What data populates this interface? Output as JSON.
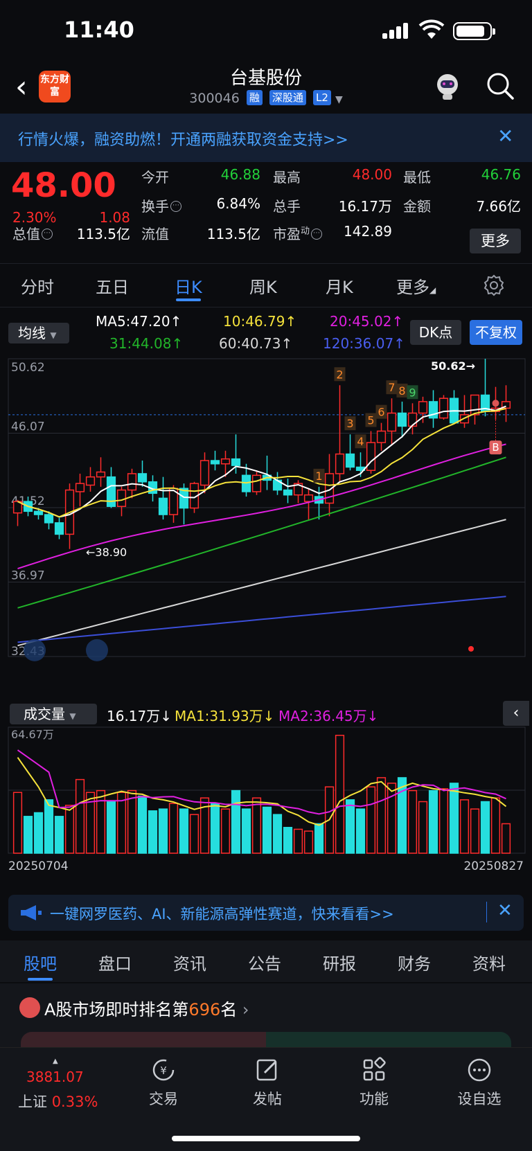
{
  "status": {
    "time": "11:40"
  },
  "header": {
    "title": "台基股份",
    "code": "300046",
    "tags": [
      "融",
      "深股通",
      "L2"
    ],
    "logo_text": "东方财富"
  },
  "promo_top": {
    "text": "行情火爆，融资助燃！开通两融获取资金支持>>",
    "close": "✕"
  },
  "quote": {
    "price": "48.00",
    "change_pct": "2.30%",
    "change": "1.08",
    "open_label": "今开",
    "open": "46.88",
    "high_label": "最高",
    "high": "48.00",
    "low_label": "最低",
    "low": "46.76",
    "turnover_label": "换手",
    "turnover": "6.84%",
    "volume_label": "总手",
    "volume": "16.17万",
    "amount_label": "金额",
    "amount": "7.66亿",
    "mcap_label": "总值",
    "mcap": "113.5亿",
    "float_label": "流值",
    "float": "113.5亿",
    "pe_label": "市盈",
    "pe_sup": "动",
    "pe": "142.89",
    "more": "更多"
  },
  "tabs": [
    "分时",
    "五日",
    "日K",
    "周K",
    "月K",
    "更多"
  ],
  "ma_bar": {
    "select": "均线",
    "ma5": "MA5:47.20↑",
    "ma10": "10:46.79↑",
    "ma20": "20:45.02↑",
    "ma31": "31:44.08↑",
    "ma60": "60:40.73↑",
    "ma120": "120:36.07↑",
    "dk": "DK点",
    "fq": "不复权"
  },
  "chart_data": {
    "type": "candlestick",
    "y_ticks": [
      "50.62",
      "46.07",
      "41.52",
      "36.97",
      "32.43"
    ],
    "ylim": [
      32.43,
      50.62
    ],
    "x_start": "20250704",
    "x_end": "20250827",
    "annotations": {
      "high": "50.62→",
      "low": "←38.90",
      "buy": "B",
      "seq": [
        "1",
        "2",
        "3",
        "4",
        "5",
        "6",
        "7",
        "8",
        "9"
      ]
    },
    "candles": [
      [
        41.2,
        42.0,
        40.4,
        41.9
      ],
      [
        41.9,
        42.2,
        41.0,
        41.3
      ],
      [
        41.3,
        41.5,
        40.8,
        41.1
      ],
      [
        41.1,
        41.3,
        40.2,
        40.6
      ],
      [
        40.6,
        40.9,
        39.6,
        39.9
      ],
      [
        39.9,
        43.0,
        39.0,
        42.6
      ],
      [
        42.5,
        43.6,
        41.6,
        43.0
      ],
      [
        42.9,
        44.0,
        42.5,
        43.4
      ],
      [
        43.4,
        44.6,
        42.8,
        43.7
      ],
      [
        43.4,
        44.0,
        41.5,
        41.6
      ],
      [
        41.6,
        42.8,
        41.0,
        42.6
      ],
      [
        42.6,
        43.9,
        42.1,
        43.6
      ],
      [
        43.6,
        44.4,
        42.8,
        43.1
      ],
      [
        43.1,
        43.5,
        41.9,
        42.4
      ],
      [
        42.1,
        43.4,
        40.8,
        41.1
      ],
      [
        41.1,
        42.9,
        40.6,
        42.7
      ],
      [
        42.7,
        43.0,
        40.5,
        41.5
      ],
      [
        41.5,
        43.1,
        41.2,
        43.0
      ],
      [
        42.9,
        44.9,
        42.4,
        44.4
      ],
      [
        44.4,
        45.0,
        43.8,
        44.2
      ],
      [
        44.2,
        45.0,
        43.4,
        44.5
      ],
      [
        44.5,
        46.0,
        43.6,
        44.1
      ],
      [
        43.5,
        44.2,
        42.2,
        42.5
      ],
      [
        42.5,
        43.8,
        42.3,
        43.5
      ],
      [
        43.5,
        44.7,
        42.6,
        43.2
      ],
      [
        43.2,
        43.7,
        42.3,
        42.6
      ],
      [
        42.6,
        43.3,
        41.8,
        42.3
      ],
      [
        42.3,
        43.2,
        41.8,
        43.0
      ],
      [
        41.9,
        42.7,
        40.8,
        42.3
      ],
      [
        42.2,
        42.8,
        40.8,
        41.8
      ],
      [
        41.8,
        44.8,
        41.0,
        43.6
      ],
      [
        43.6,
        49.0,
        43.1,
        44.8
      ],
      [
        44.8,
        46.0,
        43.8,
        44.0
      ],
      [
        44.0,
        44.9,
        43.4,
        43.8
      ],
      [
        43.8,
        46.2,
        43.6,
        45.5
      ],
      [
        45.5,
        46.7,
        45.0,
        46.2
      ],
      [
        46.2,
        48.2,
        45.4,
        47.3
      ],
      [
        47.3,
        48.0,
        45.8,
        46.5
      ],
      [
        46.5,
        47.9,
        46.0,
        47.3
      ],
      [
        47.3,
        48.3,
        46.7,
        48.0
      ],
      [
        48.0,
        48.7,
        46.4,
        47.0
      ],
      [
        47.0,
        48.4,
        46.9,
        48.2
      ],
      [
        48.2,
        48.7,
        46.8,
        46.7
      ],
      [
        46.7,
        48.4,
        46.4,
        47.2
      ],
      [
        47.2,
        48.4,
        46.6,
        48.4
      ],
      [
        48.4,
        50.62,
        47.1,
        47.4
      ],
      [
        47.4,
        48.9,
        46.9,
        47.6
      ],
      [
        47.6,
        49.0,
        46.76,
        48.0
      ]
    ],
    "ma_colors": {
      "ma5": "#ffffff",
      "ma10": "#f5e23b",
      "ma20": "#e020e0",
      "ma31": "#22b52a",
      "ma60": "#d8d8d8",
      "ma120": "#3b4ed8"
    }
  },
  "volume": {
    "select": "成交量",
    "vol": "16.17万↓",
    "ma1": "MA1:31.93万↓",
    "ma2": "MA2:36.45万↓",
    "max_label": "64.67万",
    "date_start": "20250704",
    "date_end": "20250827"
  },
  "promo_bottom": {
    "text": "一键网罗医药、AI、新能源高弹性赛道，快来看看>>",
    "close": "✕"
  },
  "bottom_tabs": [
    "股吧",
    "盘口",
    "资讯",
    "公告",
    "研报",
    "财务",
    "资料"
  ],
  "rank": {
    "prefix": "A股市场即时排名第",
    "num": "696",
    "suffix": "名"
  },
  "dock": {
    "index_value": "3881.07",
    "index_name": "上证",
    "index_pct": "0.33%",
    "items": [
      "交易",
      "发帖",
      "功能",
      "设自选"
    ]
  },
  "colors": {
    "up": "#ff2b2b",
    "down": "#22d13a",
    "down_candle": "#26dede",
    "accent": "#3d8cff"
  }
}
